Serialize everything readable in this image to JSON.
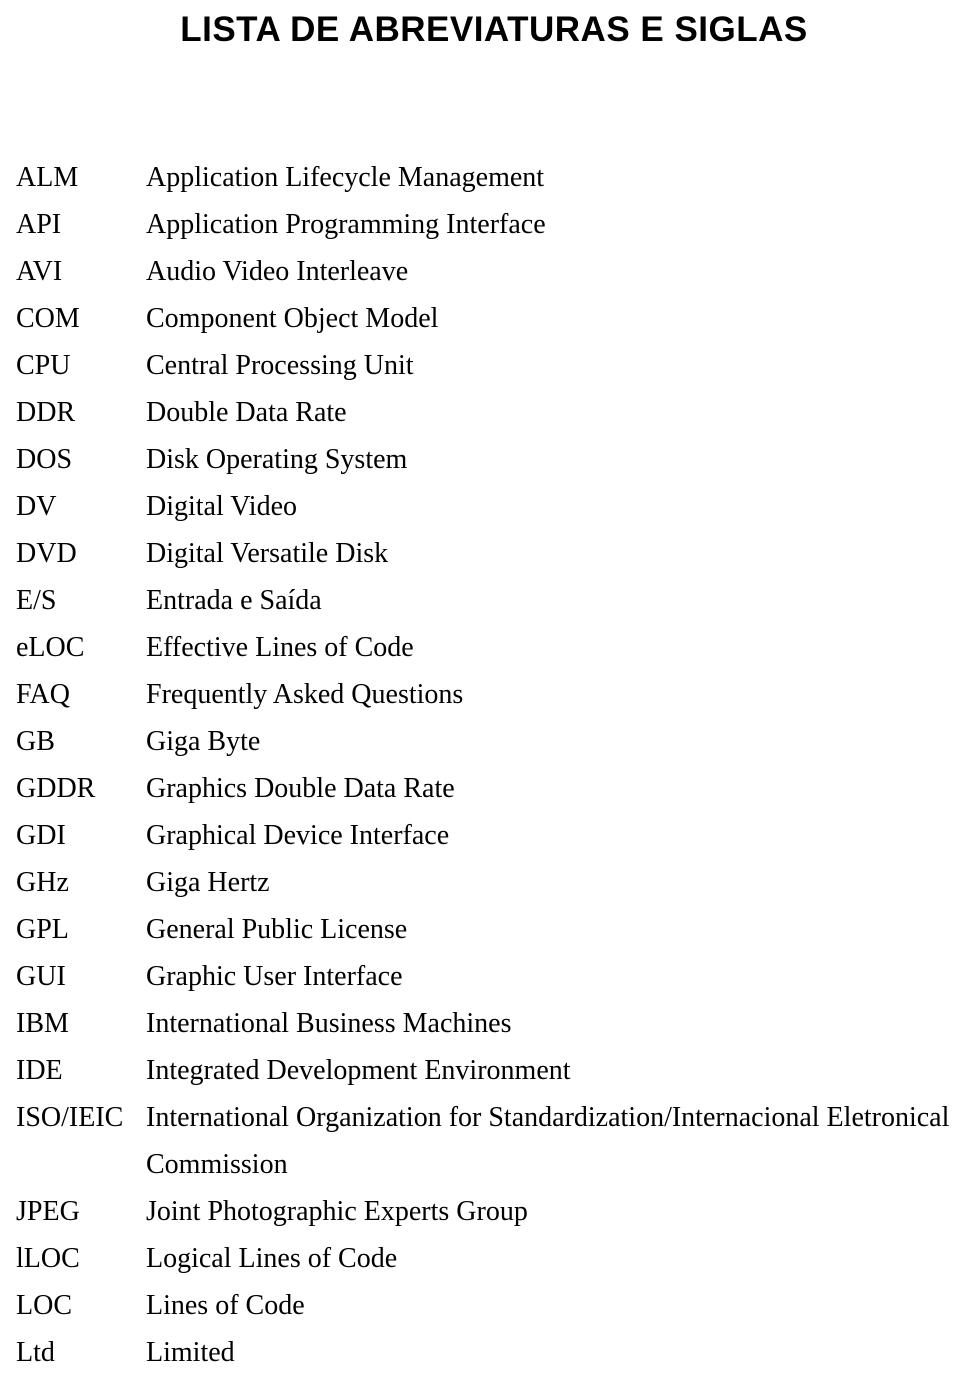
{
  "document": {
    "title": "LISTA DE ABREVIATURAS E SIGLAS",
    "entries": [
      {
        "term": "ALM",
        "definition": "Application Lifecycle Management"
      },
      {
        "term": "API",
        "definition": "Application Programming Interface"
      },
      {
        "term": "AVI",
        "definition": "Audio Video Interleave"
      },
      {
        "term": "COM",
        "definition": "Component Object Model"
      },
      {
        "term": "CPU",
        "definition": "Central Processing Unit"
      },
      {
        "term": "DDR",
        "definition": "Double Data Rate"
      },
      {
        "term": "DOS",
        "definition": "Disk Operating System"
      },
      {
        "term": "DV",
        "definition": "Digital Video"
      },
      {
        "term": "DVD",
        "definition": "Digital Versatile Disk"
      },
      {
        "term": "E/S",
        "definition": "Entrada e Saída"
      },
      {
        "term": "eLOC",
        "definition": "Effective Lines of Code"
      },
      {
        "term": "FAQ",
        "definition": "Frequently Asked Questions"
      },
      {
        "term": "GB",
        "definition": "Giga Byte"
      },
      {
        "term": "GDDR",
        "definition": "Graphics Double Data Rate"
      },
      {
        "term": "GDI",
        "definition": "Graphical Device Interface"
      },
      {
        "term": "GHz",
        "definition": "Giga Hertz"
      },
      {
        "term": "GPL",
        "definition": "General Public License"
      },
      {
        "term": "GUI",
        "definition": "Graphic User Interface"
      },
      {
        "term": "IBM",
        "definition": "International Business Machines"
      },
      {
        "term": "IDE",
        "definition": "Integrated Development Environment"
      },
      {
        "term": "ISO/IEIC",
        "definition": "International Organization for Standardization/Internacional Eletronical Commission"
      },
      {
        "term": "JPEG",
        "definition": "Joint Photographic Experts Group"
      },
      {
        "term": "lLOC",
        "definition": "Logical Lines of Code"
      },
      {
        "term": "LOC",
        "definition": "Lines of Code"
      },
      {
        "term": "Ltd",
        "definition": "Limited"
      }
    ]
  }
}
